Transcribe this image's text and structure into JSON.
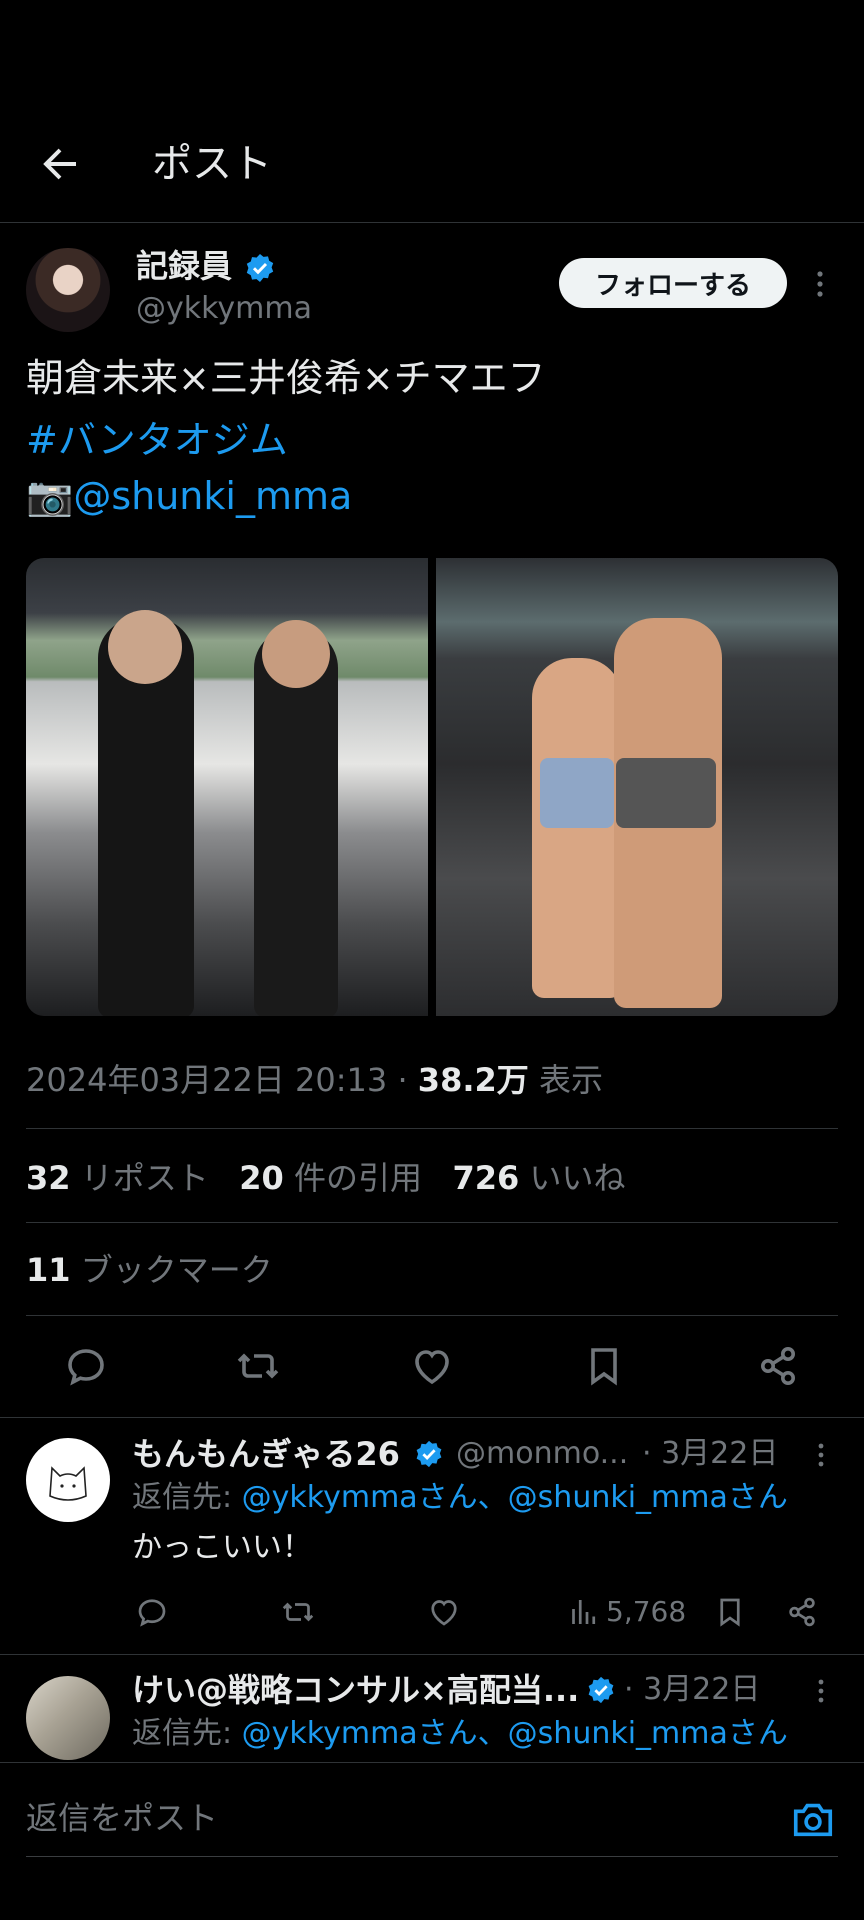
{
  "header": {
    "title": "ポスト",
    "back_icon": "arrow-left-icon"
  },
  "author": {
    "name": "記録員",
    "handle": "@ykkymma",
    "verified_color": "#1d9bf0",
    "follow_label": "フォローする"
  },
  "post": {
    "line1": "朝倉未来×三井俊希×チマエフ",
    "hashtag": "#バンタオジム",
    "camera_emoji": "📷",
    "mention": "@shunki_mma"
  },
  "meta": {
    "timestamp": "2024年03月22日 20:13",
    "sep": " · ",
    "views_value": "38.2万",
    "views_label": "表示"
  },
  "stats": {
    "reposts_value": "32",
    "reposts_label": "リポスト",
    "quotes_value": "20",
    "quotes_label": "件の引用",
    "likes_value": "726",
    "likes_label": "いいね",
    "bookmarks_value": "11",
    "bookmarks_label": "ブックマーク"
  },
  "replies": [
    {
      "name": "もんもんぎゃる26",
      "handle": "@monmo...",
      "date": "· 3月22日",
      "reply_to_label": "返信先: ",
      "reply_to": "@ykkymmaさん、@shunki_mmaさん",
      "text": "かっこいい！",
      "views": "5,768"
    },
    {
      "name": "けい@戦略コンサル×高配当...",
      "date": "· 3月22日",
      "reply_to_label": "返信先: ",
      "reply_to": "@ykkymmaさん、@shunki_mmaさん"
    }
  ],
  "composer": {
    "placeholder": "返信をポスト"
  },
  "colors": {
    "accent": "#1d9bf0",
    "background": "#000000",
    "divider": "#2f3336",
    "muted": "#71767b"
  }
}
